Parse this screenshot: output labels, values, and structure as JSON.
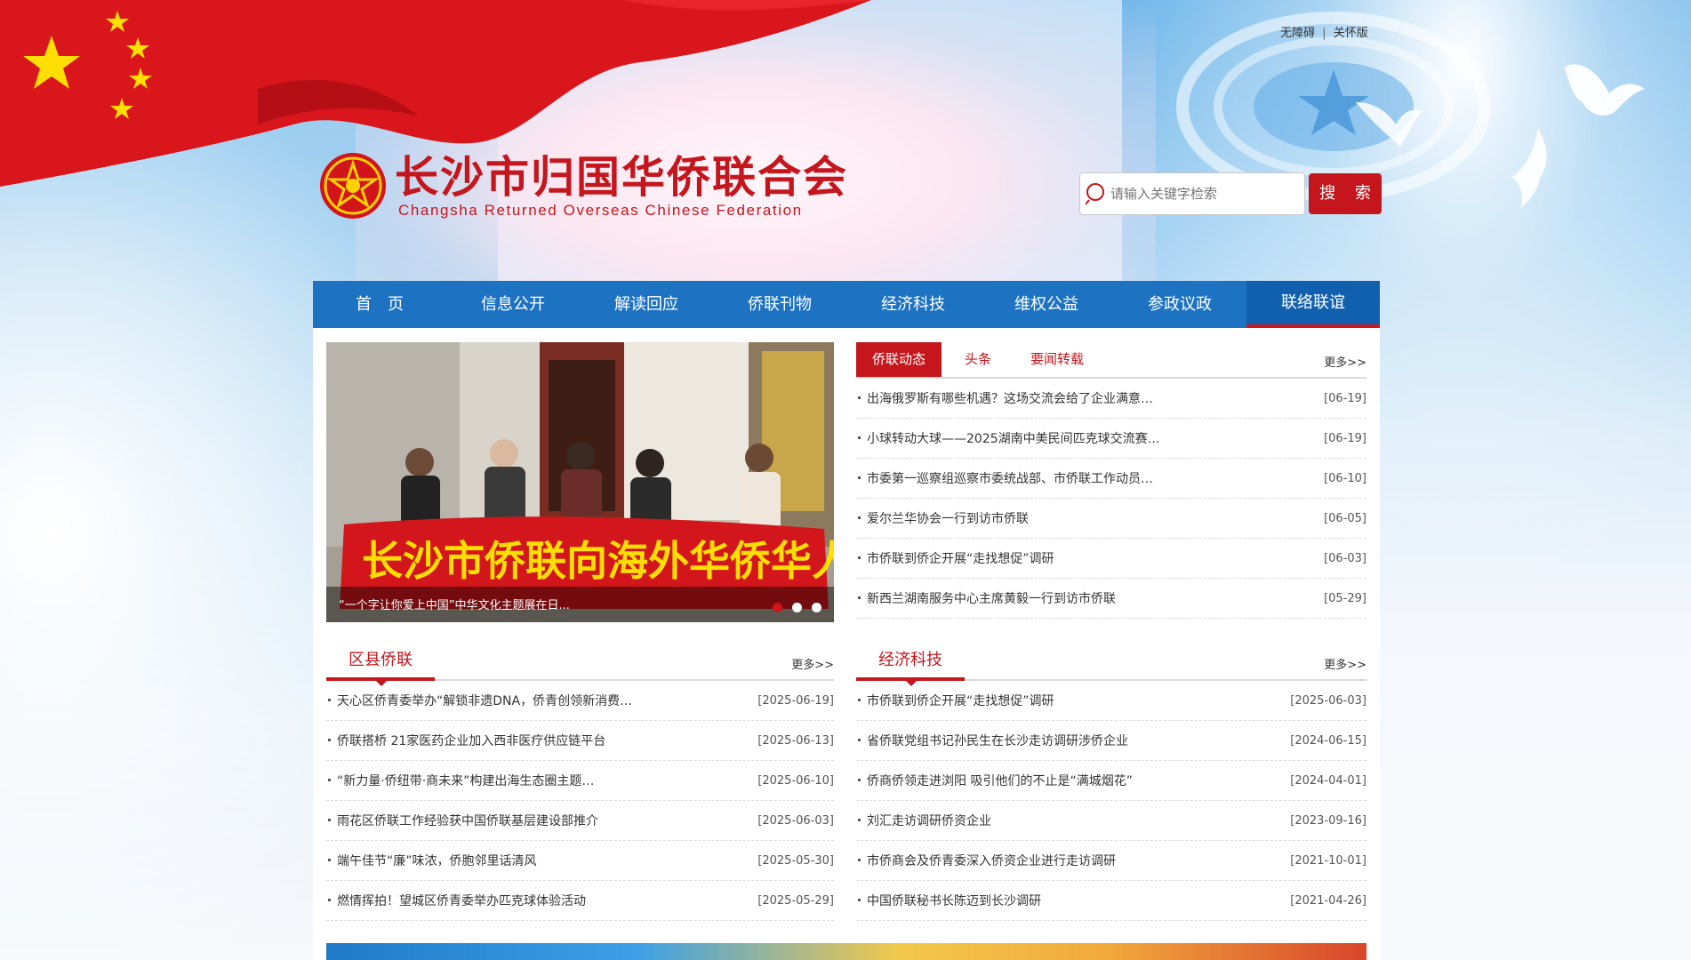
{
  "top_links": {
    "accessibility": "无障碍",
    "separator": "|",
    "care": "关怀版"
  },
  "logo": {
    "title": "长沙市归国华侨联合会",
    "subtitle": "Changsha Returned Overseas Chinese Federation"
  },
  "search": {
    "placeholder": "请输入关键字检索",
    "button": "搜 索"
  },
  "nav": [
    {
      "label": "首　页"
    },
    {
      "label": "信息公开"
    },
    {
      "label": "解读回应"
    },
    {
      "label": "侨联刊物"
    },
    {
      "label": "经济科技"
    },
    {
      "label": "维权公益"
    },
    {
      "label": "参政议政"
    },
    {
      "label": "联络联谊"
    }
  ],
  "slider": {
    "caption": "“一个字让你爱上中国”中华文化主题展在日...",
    "banner_text": "长沙市侨联向海外华侨华人问好",
    "active_dot": 1,
    "dot_count": 3
  },
  "news_tabs": {
    "tabs": [
      "侨联动态",
      "头条",
      "要闻转载"
    ],
    "more": "更多>>",
    "items": [
      {
        "title": "出海俄罗斯有哪些机遇？这场交流会给了企业满意…",
        "date": "[06-19]"
      },
      {
        "title": "小球转动大球——2025湖南中美民间匹克球交流赛…",
        "date": "[06-19]"
      },
      {
        "title": "市委第一巡察组巡察市委统战部、市侨联工作动员…",
        "date": "[06-10]"
      },
      {
        "title": "爱尔兰华协会一行到访市侨联",
        "date": "[06-05]"
      },
      {
        "title": "市侨联到侨企开展“走找想促”调研",
        "date": "[06-03]"
      },
      {
        "title": "新西兰湖南服务中心主席黄毅一行到访市侨联",
        "date": "[05-29]"
      }
    ]
  },
  "county": {
    "title": "区县侨联",
    "more": "更多>>",
    "items": [
      {
        "title": "天心区侨青委举办“解锁非遗DNA，侨青创领新消费…",
        "date": "[2025-06-19]"
      },
      {
        "title": "侨联搭桥 21家医药企业加入西非医疗供应链平台",
        "date": "[2025-06-13]"
      },
      {
        "title": "“新力量·侨纽带·商未来”构建出海生态圈主题…",
        "date": "[2025-06-10]"
      },
      {
        "title": "雨花区侨联工作经验获中国侨联基层建设部推介",
        "date": "[2025-06-03]"
      },
      {
        "title": "端午佳节“廉”味浓，侨胞邻里话清风",
        "date": "[2025-05-30]"
      },
      {
        "title": "燃情挥拍！望城区侨青委举办匹克球体验活动",
        "date": "[2025-05-29]"
      }
    ]
  },
  "economy": {
    "title": "经济科技",
    "more": "更多>>",
    "items": [
      {
        "title": "市侨联到侨企开展“走找想促”调研",
        "date": "[2025-06-03]"
      },
      {
        "title": "省侨联党组书记孙民生在长沙走访调研涉侨企业",
        "date": "[2024-06-15]"
      },
      {
        "title": "侨商侨领走进浏阳 吸引他们的不止是“满城烟花”",
        "date": "[2024-04-01]"
      },
      {
        "title": "刘汇走访调研侨资企业",
        "date": "[2023-09-16]"
      },
      {
        "title": "市侨商会及侨青委深入侨资企业进行走访调研",
        "date": "[2021-10-01]"
      },
      {
        "title": "中国侨联秘书长陈迈到长沙调研",
        "date": "[2021-04-26]"
      }
    ]
  },
  "colors": {
    "brand_red": "#c4161c",
    "nav_blue": "#1d73c2"
  }
}
